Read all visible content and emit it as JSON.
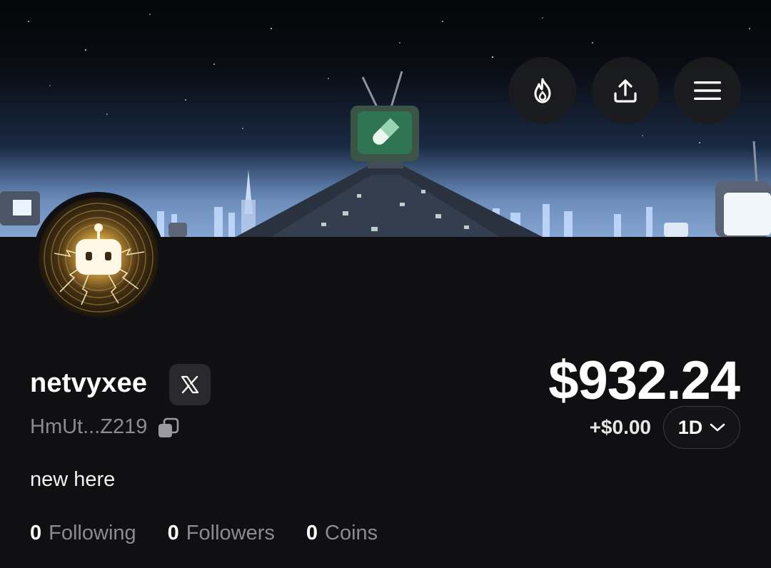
{
  "banner": {
    "description_icon": "pill-tv-icon"
  },
  "actions": {
    "fire_icon": "fire-icon",
    "share_icon": "share-upload-icon",
    "menu_icon": "hamburger-menu-icon"
  },
  "profile": {
    "username": "netvyxee",
    "social_badge": "X",
    "address": "HmUt...Z219",
    "bio": "new here",
    "avatar_icon": "robot-lightning-avatar"
  },
  "stats": [
    {
      "value": "0",
      "label": "Following"
    },
    {
      "value": "0",
      "label": "Followers"
    },
    {
      "value": "0",
      "label": "Coins"
    }
  ],
  "portfolio": {
    "balance": "$932.24",
    "change": "+$0.00",
    "period": "1D"
  },
  "colors": {
    "background": "#101012",
    "button_bg": "#1c1c1e",
    "muted_text": "#8b8b90",
    "tv_green": "#4fa37a"
  }
}
